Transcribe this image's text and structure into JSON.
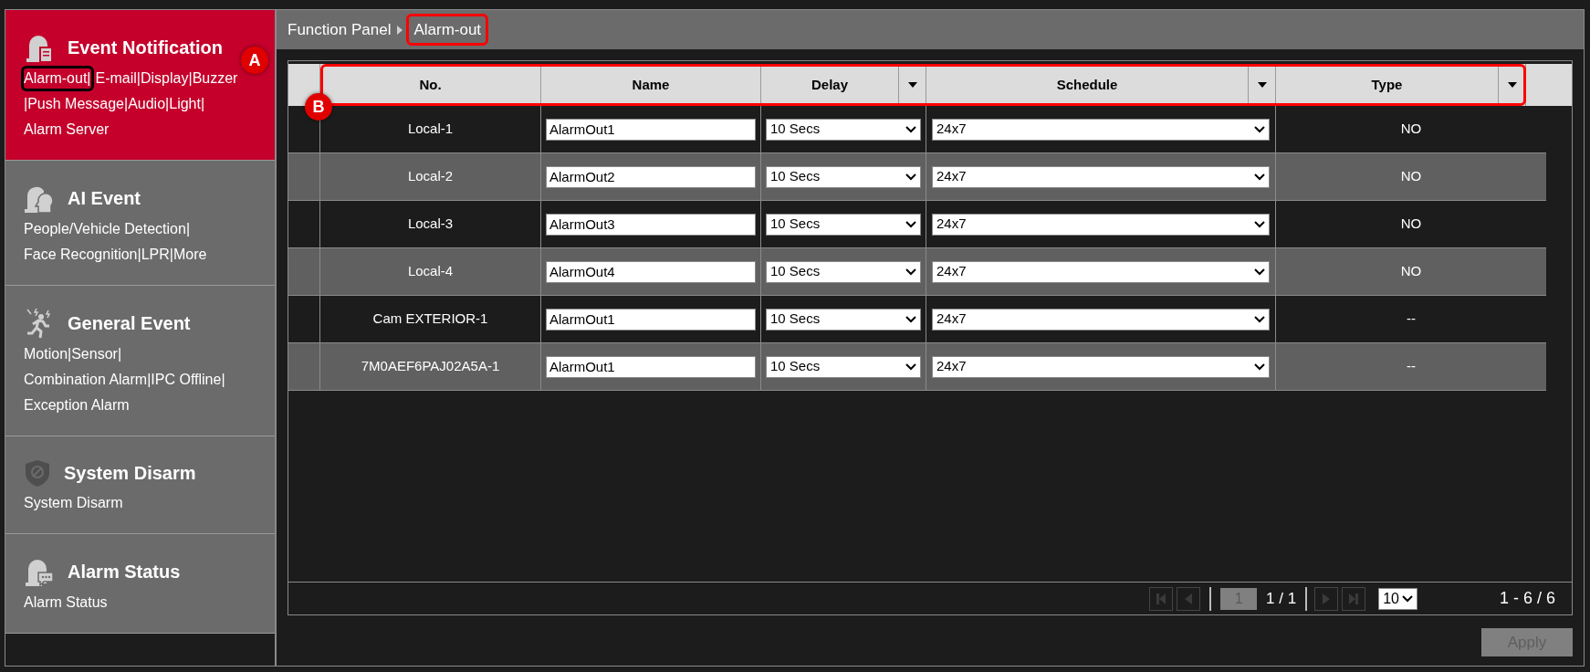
{
  "sidebar": {
    "sections": [
      {
        "title": "Event Notification",
        "selected": true,
        "lines": [
          [
            {
              "text": "Alarm-out|",
              "highlighted": true
            },
            {
              "text": "E-mail|Display|Buzzer",
              "highlighted": false
            }
          ],
          [
            {
              "text": "|Push Message|Audio|Light|",
              "highlighted": false
            }
          ],
          [
            {
              "text": "Alarm Server",
              "highlighted": false
            }
          ]
        ]
      },
      {
        "title": "AI Event",
        "selected": false,
        "lines": [
          [
            {
              "text": "People/Vehicle Detection|",
              "highlighted": false
            }
          ],
          [
            {
              "text": "Face Recognition|LPR|More",
              "highlighted": false
            }
          ]
        ]
      },
      {
        "title": "General Event",
        "selected": false,
        "lines": [
          [
            {
              "text": "Motion|Sensor|",
              "highlighted": false
            }
          ],
          [
            {
              "text": "Combination Alarm|IPC Offline|",
              "highlighted": false
            }
          ],
          [
            {
              "text": "Exception Alarm",
              "highlighted": false
            }
          ]
        ]
      },
      {
        "title": "System Disarm",
        "selected": false,
        "lines": [
          [
            {
              "text": "System Disarm",
              "highlighted": false
            }
          ]
        ]
      },
      {
        "title": "Alarm Status",
        "selected": false,
        "lines": [
          [
            {
              "text": "Alarm Status",
              "highlighted": false
            }
          ]
        ]
      }
    ]
  },
  "breadcrumb": [
    {
      "text": "Function Panel",
      "highlighted": false
    },
    {
      "text": "Alarm-out",
      "highlighted": true
    }
  ],
  "callouts": [
    {
      "label": "A"
    },
    {
      "label": "B"
    }
  ],
  "table": {
    "header_highlighted": true,
    "columns": [
      {
        "label": "No.",
        "filter": false
      },
      {
        "label": "Name",
        "filter": false
      },
      {
        "label": "Delay",
        "filter": true
      },
      {
        "label": "Schedule",
        "filter": true
      },
      {
        "label": "Type",
        "filter": true
      }
    ],
    "rows": [
      {
        "no": "Local-1",
        "name": "AlarmOut1",
        "delay": "10 Secs",
        "schedule": "24x7",
        "type": "NO"
      },
      {
        "no": "Local-2",
        "name": "AlarmOut2",
        "delay": "10 Secs",
        "schedule": "24x7",
        "type": "NO"
      },
      {
        "no": "Local-3",
        "name": "AlarmOut3",
        "delay": "10 Secs",
        "schedule": "24x7",
        "type": "NO"
      },
      {
        "no": "Local-4",
        "name": "AlarmOut4",
        "delay": "10 Secs",
        "schedule": "24x7",
        "type": "NO"
      },
      {
        "no": "Cam EXTERIOR-1",
        "name": "AlarmOut1",
        "delay": "10 Secs",
        "schedule": "24x7",
        "type": "--"
      },
      {
        "no": "7M0AEF6PAJ02A5A-1",
        "name": "AlarmOut1",
        "delay": "10 Secs",
        "schedule": "24x7",
        "type": "--"
      }
    ]
  },
  "pagination": {
    "page": "1",
    "pages": "1 / 1",
    "per_page": "10",
    "range": "1 - 6 / 6"
  },
  "apply": {
    "label": "Apply",
    "disabled": true
  }
}
